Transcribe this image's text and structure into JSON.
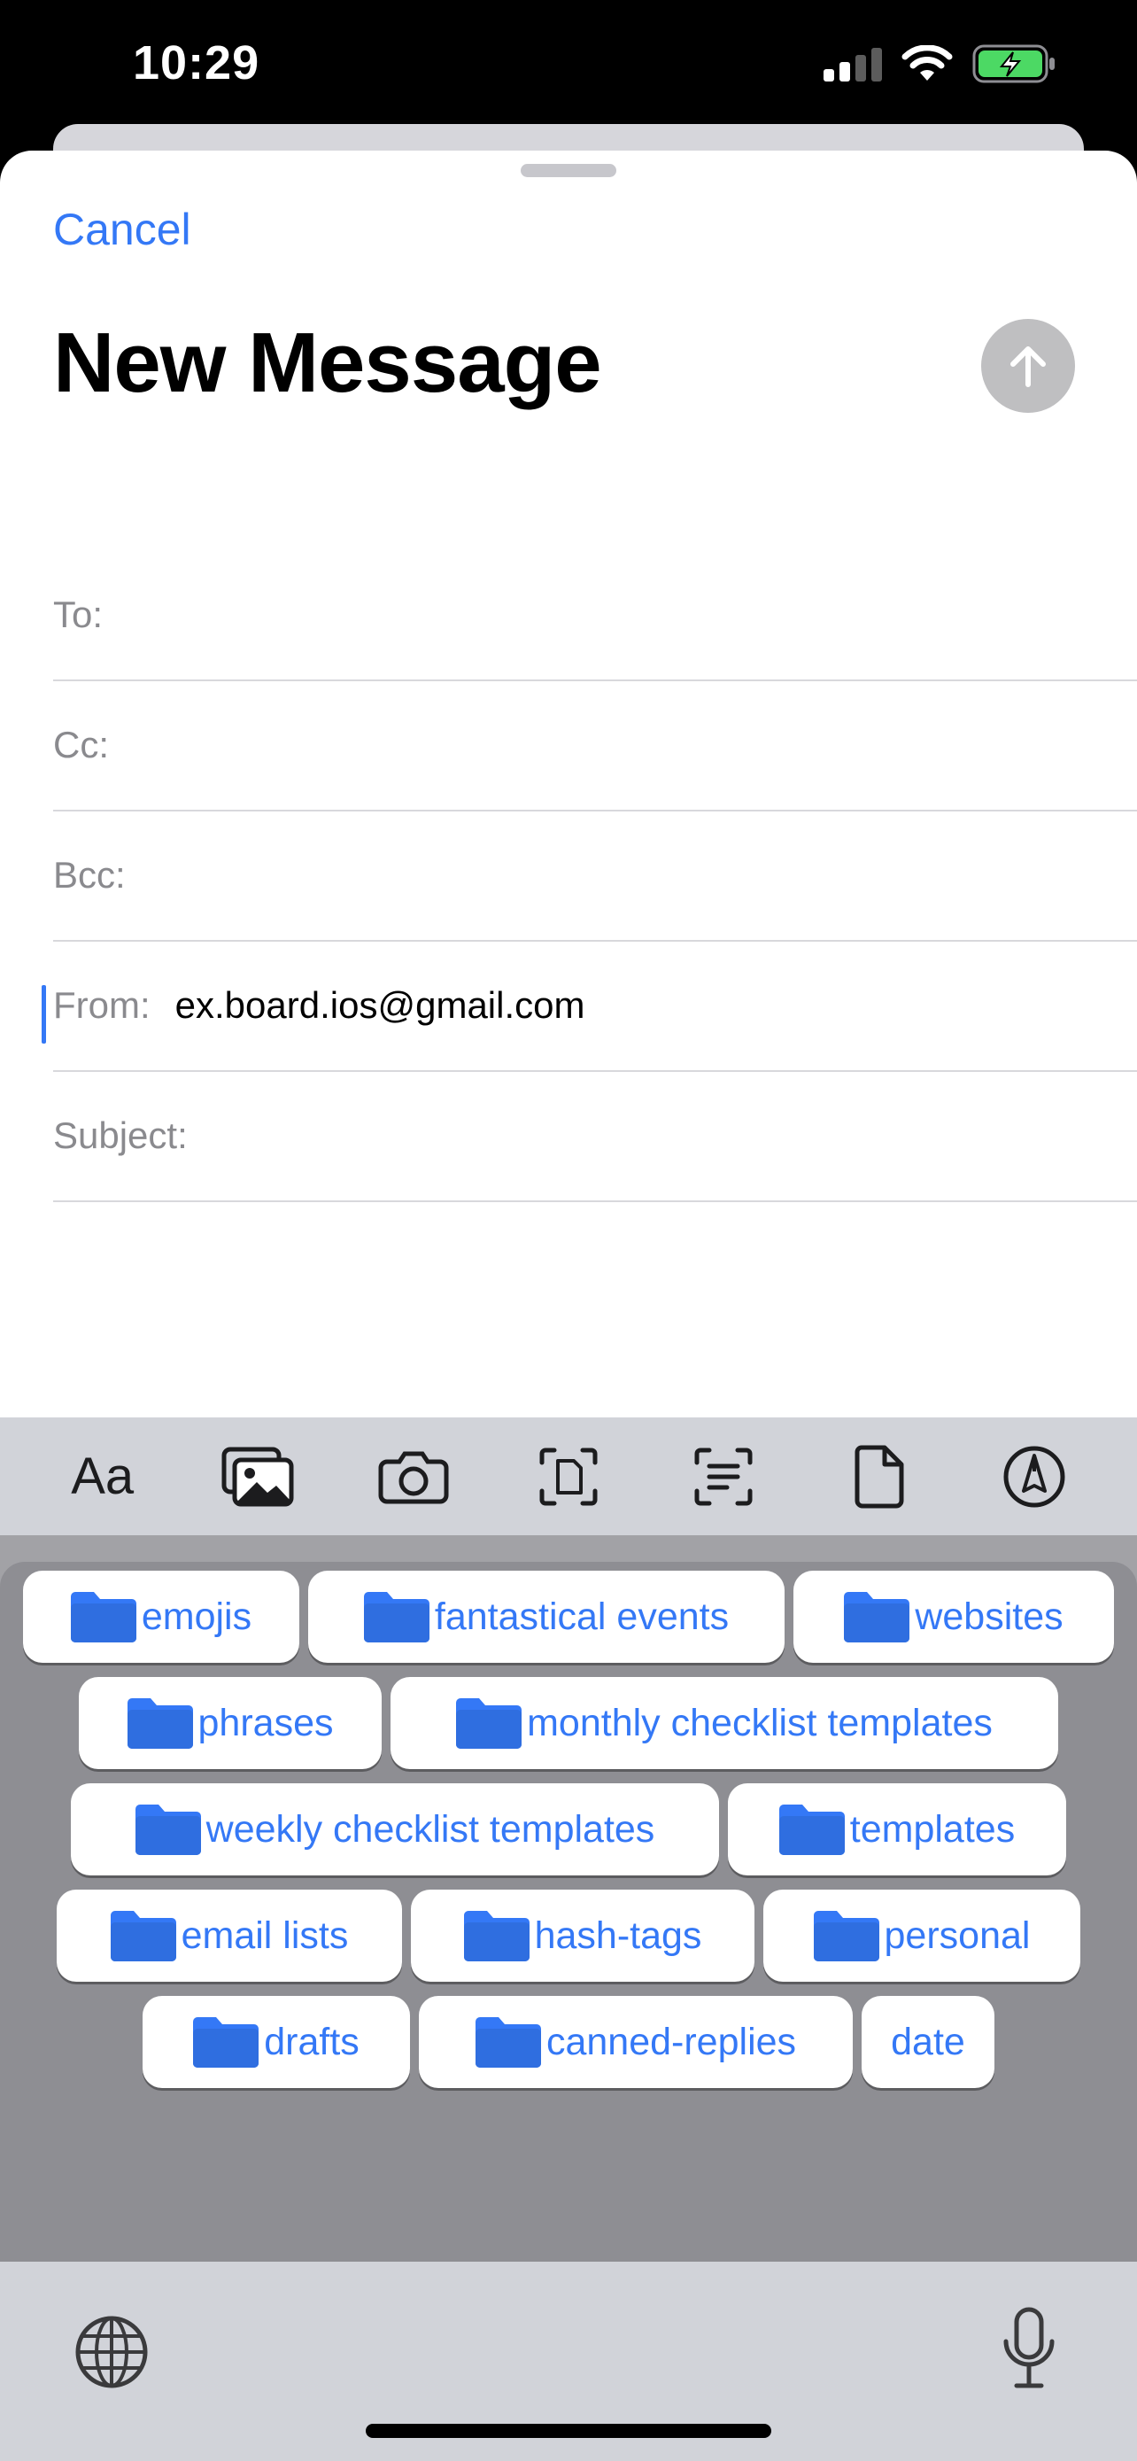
{
  "status_bar": {
    "time": "10:29",
    "icons": [
      "cellular-signal-icon",
      "wifi-icon",
      "battery-charging-icon"
    ],
    "battery_color": "#4cd964"
  },
  "compose": {
    "cancel_label": "Cancel",
    "title": "New Message",
    "send_icon": "arrow-up-icon",
    "fields": {
      "to_label": "To:",
      "cc_label": "Cc:",
      "bcc_label": "Bcc:",
      "from_label": "From:",
      "from_value": "ex.board.ios@gmail.com",
      "subject_label": "Subject:"
    }
  },
  "toolbar": {
    "format_label": "Aa",
    "icons": [
      "photo-library-icon",
      "camera-icon",
      "scan-document-icon",
      "scan-text-icon",
      "attach-file-icon",
      "markup-icon"
    ]
  },
  "keyboard": {
    "folders": {
      "emojis": "emojis",
      "fantastical_events": "fantastical events",
      "websites": "websites",
      "phrases": "phrases",
      "monthly_checklist_templates": "monthly checklist templates",
      "weekly_checklist_templates": "weekly checklist templates",
      "templates": "templates",
      "email_lists": "email lists",
      "hash_tags": "hash-tags",
      "personal": "personal",
      "drafts": "drafts",
      "canned_replies": "canned-replies"
    },
    "date_label": "date",
    "folder_icon": "folder-icon",
    "bottom_icons": [
      "globe-icon",
      "microphone-icon"
    ]
  },
  "colors": {
    "accent": "#3478f6",
    "folder": "#3478f6",
    "keyboard_panel": "#8e8e93"
  }
}
